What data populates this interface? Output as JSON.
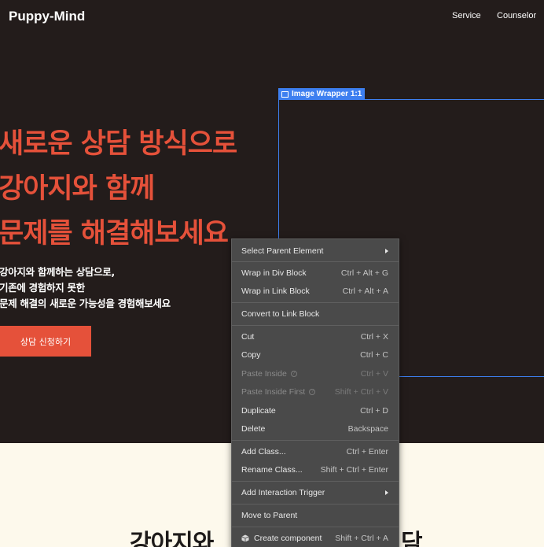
{
  "nav": {
    "logo": "Puppy-Mind",
    "links": [
      "Service",
      "Counselor"
    ]
  },
  "hero": {
    "headline": [
      "새로운 상담 방식으로",
      "강아지와 함께",
      "문제를 해결해보세요"
    ],
    "subtext": [
      "강아지와 함께하는 상담으로,",
      "기존에 경험하지 못한",
      "문제 해결의 새로운 가능성을 경험해보세요"
    ],
    "cta_label": "상담 신청하기"
  },
  "editor": {
    "selection_label": "Image Wrapper 1:1"
  },
  "context_menu": {
    "items": [
      {
        "label": "Select Parent Element",
        "shortcut": "",
        "submenu": true
      },
      {
        "label": "Wrap in Div Block",
        "shortcut": "Ctrl + Alt + G"
      },
      {
        "label": "Wrap in Link Block",
        "shortcut": "Ctrl + Alt + A"
      },
      {
        "label": "Convert to Link Block",
        "shortcut": ""
      },
      {
        "label": "Cut",
        "shortcut": "Ctrl + X"
      },
      {
        "label": "Copy",
        "shortcut": "Ctrl + C"
      },
      {
        "label": "Paste Inside",
        "shortcut": "Ctrl + V",
        "disabled": true
      },
      {
        "label": "Paste Inside First",
        "shortcut": "Shift + Ctrl + V",
        "disabled": true
      },
      {
        "label": "Duplicate",
        "shortcut": "Ctrl + D"
      },
      {
        "label": "Delete",
        "shortcut": "Backspace"
      },
      {
        "label": "Add Class...",
        "shortcut": "Ctrl + Enter"
      },
      {
        "label": "Rename Class...",
        "shortcut": "Shift + Ctrl + Enter"
      },
      {
        "label": "Add Interaction Trigger",
        "shortcut": "",
        "submenu": true
      },
      {
        "label": "Move to Parent",
        "shortcut": ""
      },
      {
        "label": "Create component",
        "shortcut": "Shift + Ctrl + A",
        "icon": "cube-icon"
      }
    ]
  },
  "lower_section": {
    "heading_left": "강아지와",
    "heading_right": "담"
  },
  "colors": {
    "background_dark": "#231c1b",
    "accent": "#e5513a",
    "selection_blue": "#3d7ff0",
    "menu_bg": "#4a4a4a",
    "lower_bg": "#fdf9ec"
  }
}
